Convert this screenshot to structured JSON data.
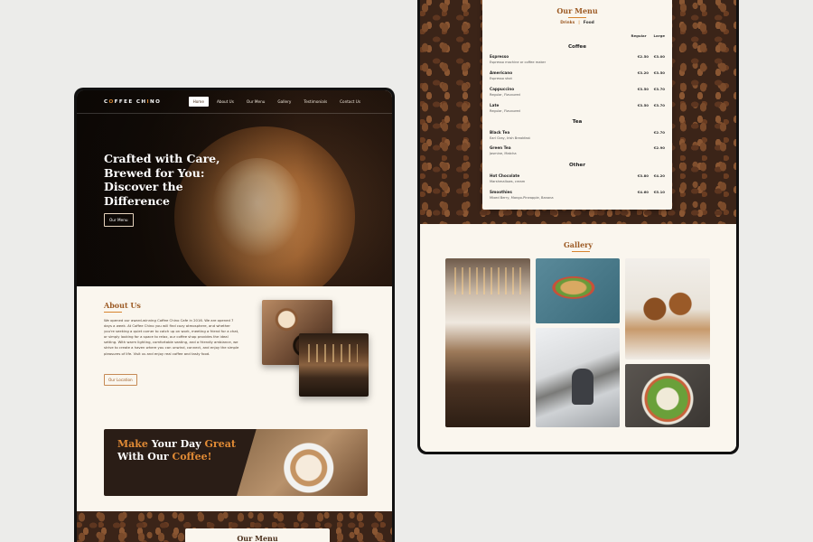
{
  "site": {
    "logo_text_1": "C",
    "logo_dot_1": "O",
    "logo_text_2": "FFEE  CH",
    "logo_dot_2": "I",
    "logo_text_3": "NO"
  },
  "nav": {
    "items": [
      "Home",
      "About Us",
      "Our Menu",
      "Gallery",
      "Testimonials",
      "Contact Us"
    ],
    "active": "Home"
  },
  "hero": {
    "title": "Crafted with Care, Brewed for You: Discover the Difference",
    "button": "Our Menu"
  },
  "about": {
    "heading": "About Us",
    "body": "We opened our award-winning Coffee Chino Cafe in 2016. We are opened 7 days a week. At Coffee Chino you will find cozy atmosphere, and whether you're seeking a quiet corner to catch up on work, meeting a friend for a chat, or simply looking for a space to relax, our coffee shop provides the ideal setting. With warm lighting, comfortable seating, and a friendly ambiance, we strive to create a haven where you can unwind, connect, and enjoy the simple pleasures of life. Visit us and enjoy real coffee and tasty food.",
    "button": "Our Location"
  },
  "banner": {
    "w1": "Make",
    "w2": " Your Day ",
    "w3": "Great",
    "w4": "With Our ",
    "w5": "Coffee!"
  },
  "menu": {
    "heading": "Our Menu",
    "tabs": [
      "Drinks",
      "Food"
    ],
    "sep": "|",
    "col_regular": "Regular",
    "col_large": "Large",
    "categories": [
      {
        "name": "Coffee",
        "items": [
          {
            "name": "Espresso",
            "desc": "Espresso machine or coffee maker",
            "regular": "€2.50",
            "large": "€3.00"
          },
          {
            "name": "Americano",
            "desc": "Espresso shot",
            "regular": "€3.20",
            "large": "€3.50"
          },
          {
            "name": "Cappuccino",
            "desc": "Regular, Flavoured",
            "regular": "€3.50",
            "large": "€3.70"
          },
          {
            "name": "Late",
            "desc": "Regular, Flavoured",
            "regular": "€3.50",
            "large": "€3.70"
          }
        ]
      },
      {
        "name": "Tea",
        "items": [
          {
            "name": "Black Tea",
            "desc": "Earl Gray, Irish Breakfast",
            "regular": "",
            "large": "€2.70"
          },
          {
            "name": "Green Tea",
            "desc": "Jasmine, Matcha",
            "regular": "",
            "large": "€2.90"
          }
        ]
      },
      {
        "name": "Other",
        "items": [
          {
            "name": "Hot Chocolate",
            "desc": "Marshmallows, cream",
            "regular": "€3.80",
            "large": "€4.20"
          },
          {
            "name": "Smoothies",
            "desc": "Mixed Berry, Mango-Pineapple, Banana",
            "regular": "€4.60",
            "large": "€5.10"
          }
        ]
      }
    ]
  },
  "gallery": {
    "heading": "Gallery"
  },
  "colors": {
    "accent": "#d7842e",
    "brand_brown": "#9c5a24",
    "dark": "#2a1d16",
    "cream": "#faf6ee"
  }
}
